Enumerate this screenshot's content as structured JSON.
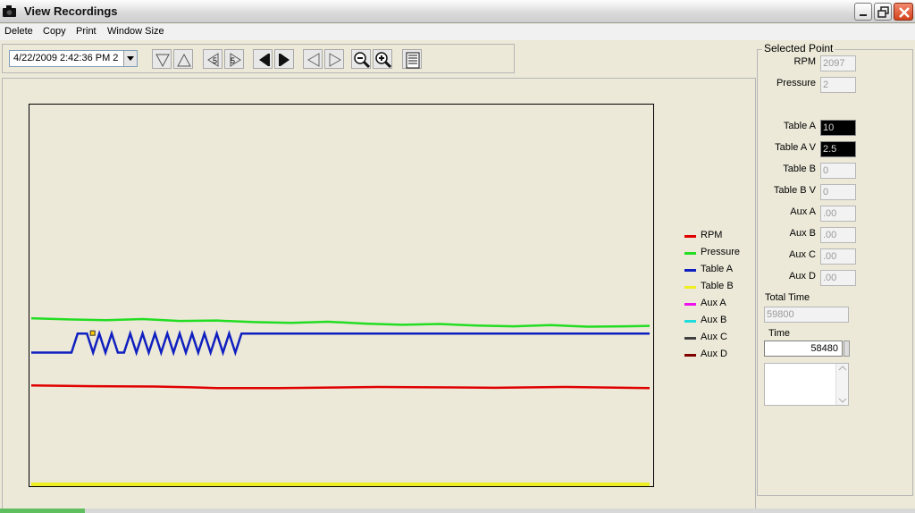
{
  "window": {
    "title": "View Recordings"
  },
  "menu": [
    "Delete",
    "Copy",
    "Print",
    "Window Size"
  ],
  "toolbar": {
    "date_value": "4/22/2009 2:42:36 PM 2"
  },
  "legend": [
    {
      "name": "RPM",
      "color": "#e00000"
    },
    {
      "name": "Pressure",
      "color": "#22dd22"
    },
    {
      "name": "Table A",
      "color": "#1020c0"
    },
    {
      "name": "Table B",
      "color": "#eeee20"
    },
    {
      "name": "Aux A",
      "color": "#ee10ee"
    },
    {
      "name": "Aux B",
      "color": "#20dddd"
    },
    {
      "name": "Aux C",
      "color": "#404040"
    },
    {
      "name": "Aux D",
      "color": "#800000"
    }
  ],
  "selected_point": {
    "title": "Selected Point",
    "rpm": {
      "label": "RPM",
      "value": "2097"
    },
    "pressure": {
      "label": "Pressure",
      "value": "2"
    },
    "table_a": {
      "label": "Table A",
      "value": "10"
    },
    "table_a_v": {
      "label": "Table A V",
      "value": "2.5"
    },
    "table_b": {
      "label": "Table B",
      "value": "0"
    },
    "table_b_v": {
      "label": "Table B V",
      "value": "0"
    },
    "aux_a": {
      "label": "Aux A",
      "value": ".00"
    },
    "aux_b": {
      "label": "Aux B",
      "value": ".00"
    },
    "aux_c": {
      "label": "Aux C",
      "value": ".00"
    },
    "aux_d": {
      "label": "Aux D",
      "value": ".00"
    },
    "total_time": {
      "label": "Total Time",
      "value": "59800"
    },
    "time": {
      "label": "Time",
      "value": "58480"
    }
  },
  "chart_data": {
    "type": "line",
    "title": "",
    "xlabel": "",
    "ylabel": "",
    "ylim": [
      0,
      100
    ],
    "series": [
      {
        "name": "Pressure",
        "color": "#22dd22",
        "x": [
          0,
          6,
          12,
          18,
          24,
          30,
          36,
          42,
          48,
          54,
          60,
          66,
          72,
          78,
          84,
          90,
          96,
          100
        ],
        "values": [
          44,
          43.7,
          43.5,
          43.8,
          43.3,
          43.4,
          43,
          42.8,
          43.1,
          42.6,
          42.3,
          42.5,
          42.1,
          41.9,
          42.2,
          41.8,
          41.9,
          42
        ]
      },
      {
        "name": "Table A",
        "color": "#1020c0",
        "x": [
          0,
          3.5,
          6.5,
          7.5,
          9,
          10,
          11,
          12,
          13,
          14,
          15,
          16,
          17,
          18,
          19,
          20,
          21,
          22,
          23,
          24,
          25,
          26,
          27,
          28,
          29,
          30,
          31,
          32,
          33,
          34,
          35,
          100
        ],
        "values": [
          35,
          35,
          35,
          40,
          40,
          35,
          40,
          35,
          40,
          35,
          35,
          40,
          35,
          40,
          35,
          40,
          35,
          40,
          35,
          40,
          35,
          40,
          35,
          40,
          35,
          40,
          35,
          40,
          35,
          40,
          40,
          40
        ]
      },
      {
        "name": "RPM",
        "color": "#e00000",
        "x": [
          0,
          10,
          20,
          26,
          30,
          40,
          56,
          65,
          75,
          86,
          100
        ],
        "values": [
          26.4,
          26.2,
          26.1,
          25.9,
          25.7,
          25.7,
          26.0,
          25.9,
          25.8,
          26.0,
          25.7
        ]
      },
      {
        "name": "Table B",
        "color": "#eeee20",
        "x": [
          0,
          100
        ],
        "values": [
          0.5,
          0.5
        ]
      }
    ]
  }
}
